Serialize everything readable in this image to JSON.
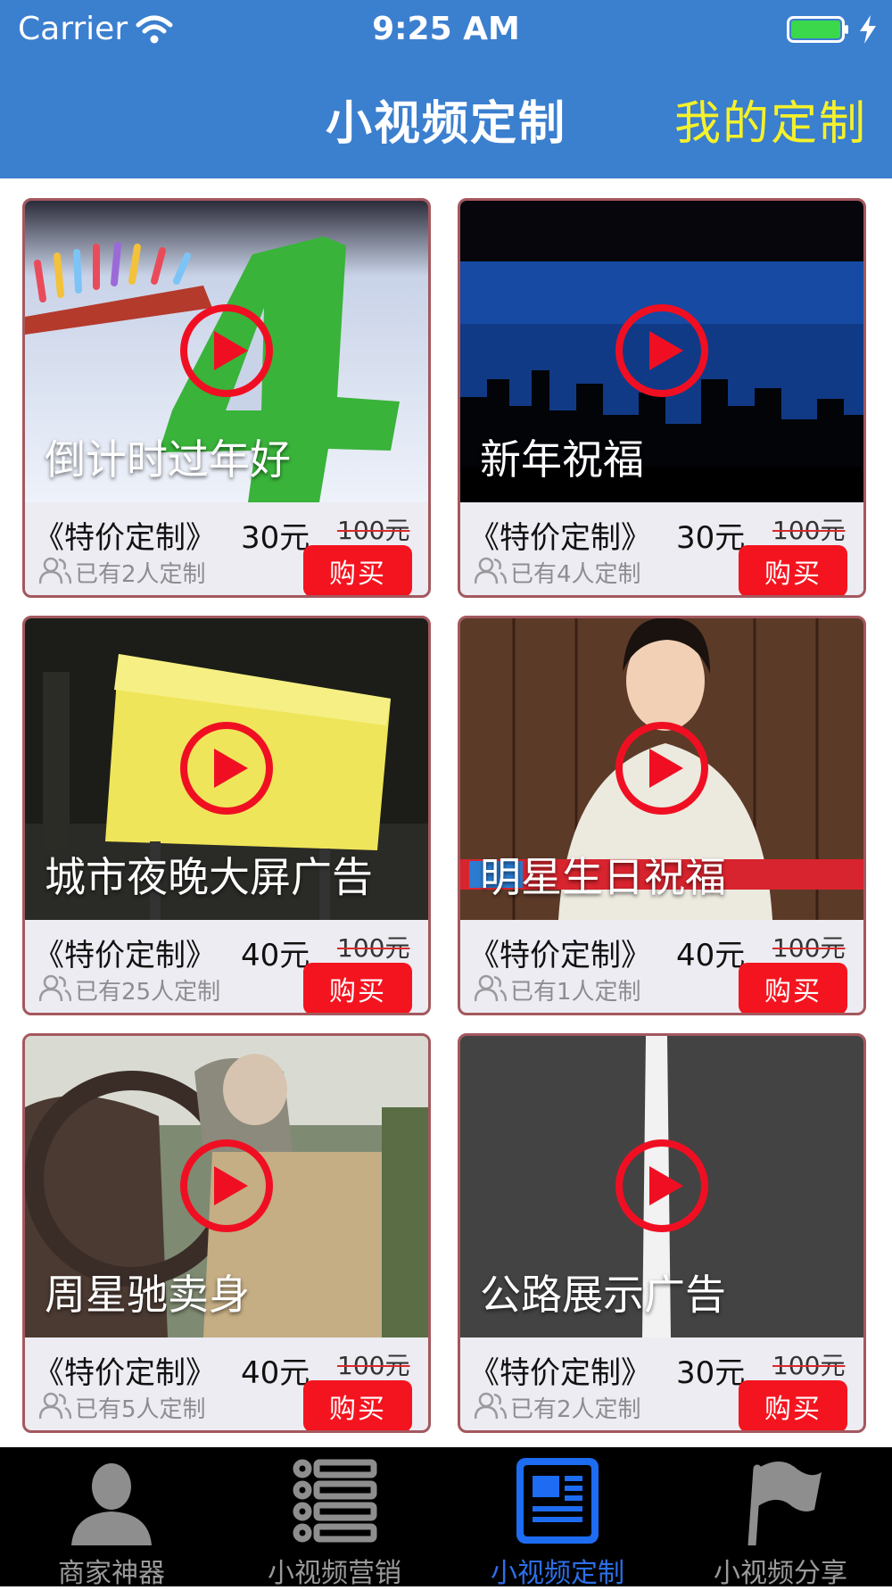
{
  "status_bar": {
    "carrier": "Carrier",
    "time": "9:25 AM"
  },
  "nav": {
    "title": "小视频定制",
    "right_button": "我的定制"
  },
  "colors": {
    "nav_bg": "#3b7fcf",
    "accent_yellow": "#f5f12a",
    "buy_red": "#f4141f",
    "tab_active": "#2d6fe8"
  },
  "cards": [
    {
      "title": "倒计时过年好",
      "label": "《特价定制》",
      "price": "30元",
      "original": "100元",
      "count": "已有2人定制",
      "buy": "购买"
    },
    {
      "title": "新年祝福",
      "label": "《特价定制》",
      "price": "30元",
      "original": "100元",
      "count": "已有4人定制",
      "buy": "购买"
    },
    {
      "title": "城市夜晚大屏广告",
      "label": "《特价定制》",
      "price": "40元",
      "original": "100元",
      "count": "已有25人定制",
      "buy": "购买"
    },
    {
      "title": "明星生日祝福",
      "label": "《特价定制》",
      "price": "40元",
      "original": "100元",
      "count": "已有1人定制",
      "buy": "购买"
    },
    {
      "title": "周星驰卖身",
      "label": "《特价定制》",
      "price": "40元",
      "original": "100元",
      "count": "已有5人定制",
      "buy": "购买"
    },
    {
      "title": "公路展示广告",
      "label": "《特价定制》",
      "price": "30元",
      "original": "100元",
      "count": "已有2人定制",
      "buy": "购买"
    }
  ],
  "tabs": [
    {
      "label": "商家神器",
      "icon": "person-icon",
      "active": false
    },
    {
      "label": "小视频营销",
      "icon": "list-icon",
      "active": false
    },
    {
      "label": "小视频定制",
      "icon": "newspaper-icon",
      "active": true
    },
    {
      "label": "小视频分享",
      "icon": "flag-icon",
      "active": false
    }
  ]
}
